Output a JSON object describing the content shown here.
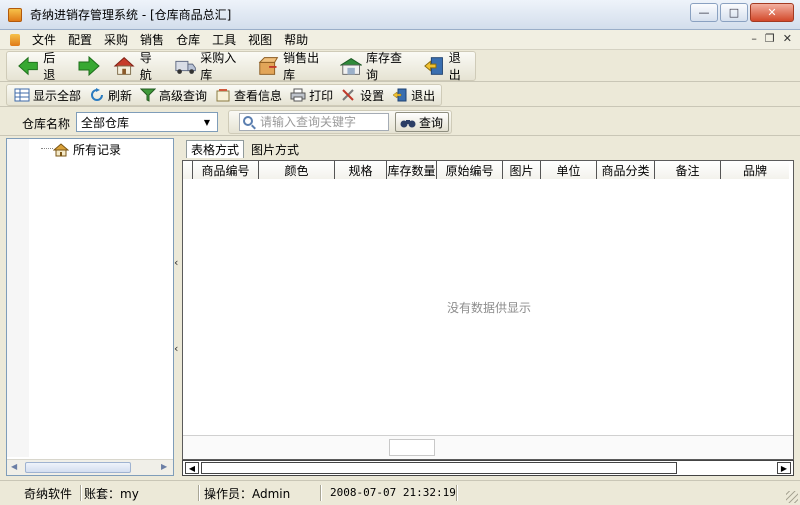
{
  "window": {
    "title": "奇纳进销存管理系统 - [仓库商品总汇]",
    "btn_min": "—",
    "btn_max": "□",
    "btn_close": "✕"
  },
  "menu": {
    "items": [
      "文件",
      "配置",
      "采购",
      "销售",
      "仓库",
      "工具",
      "视图",
      "帮助"
    ],
    "mdi_min": "–",
    "mdi_restore": "❐",
    "mdi_close": "✕"
  },
  "toolbar_main": {
    "back": "后退",
    "navigate": "导航",
    "purchase_in": "采购入库",
    "sales_out": "销售出库",
    "stock_query": "库存查询",
    "exit": "退出"
  },
  "toolbar_sub": {
    "show_all": "显示全部",
    "refresh": "刷新",
    "advanced_query": "高级查询",
    "view_info": "查看信息",
    "print": "打印",
    "settings": "设置",
    "exit": "退出"
  },
  "search": {
    "store_label": "仓库名称",
    "store_value": "全部仓库",
    "keyword_placeholder": "请输入查询关键字",
    "query_button": "查询"
  },
  "tree": {
    "root": "所有记录"
  },
  "tabs": {
    "table_view": "表格方式",
    "image_view": "图片方式"
  },
  "grid": {
    "columns": [
      "商品编号",
      "颜色",
      "规格",
      "库存数量",
      "原始编号",
      "图片",
      "单位",
      "商品分类",
      "备注",
      "品牌"
    ],
    "empty_message": "没有数据供显示"
  },
  "statusbar": {
    "company": "奇纳软件",
    "account": "账套：my",
    "operator": "操作员：Admin",
    "datetime": "2008-07-07 21:32:19"
  },
  "colors": {
    "accent_green": "#2e9e2a",
    "window_face": "#ece9d8",
    "border_blue": "#7f9db9"
  }
}
